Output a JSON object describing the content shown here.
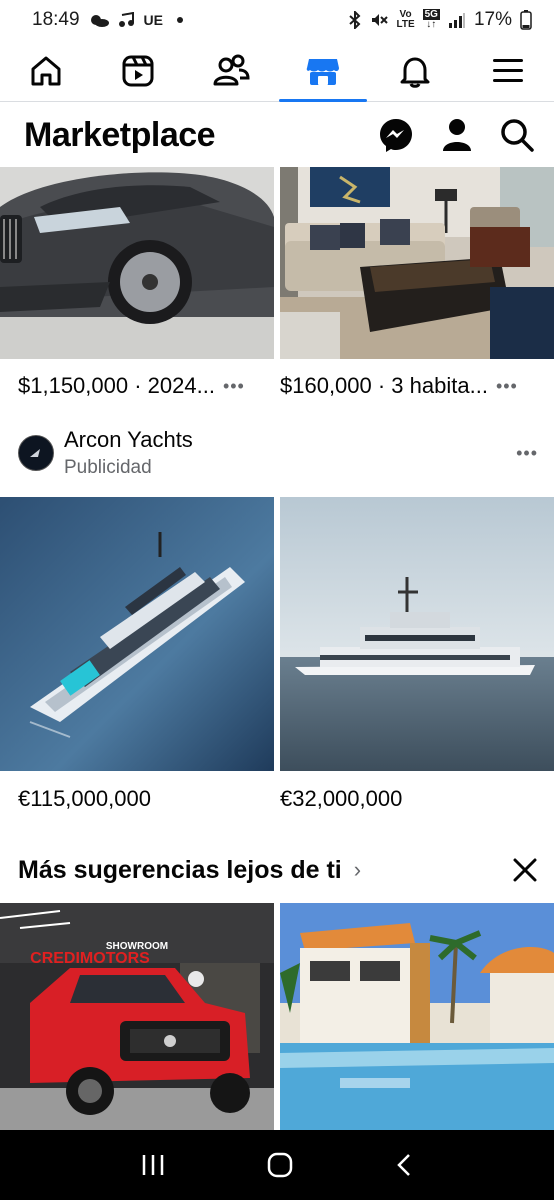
{
  "status": {
    "time": "18:49",
    "carrier": "UE",
    "network": "5G",
    "battery": "17%"
  },
  "nav": {
    "tabs": [
      "home",
      "reels",
      "friends",
      "marketplace",
      "notifications",
      "menu"
    ],
    "active": "marketplace"
  },
  "header": {
    "title": "Marketplace"
  },
  "listings_top": [
    {
      "price": "$1,150,000 · 2024...",
      "more": "•••"
    },
    {
      "price": "$160,000 · 3 habita...",
      "more": "•••"
    }
  ],
  "ad": {
    "name": "Arcon Yachts",
    "label": "Publicidad",
    "more": "•••"
  },
  "yacht_listings": [
    {
      "price": "€115,000,000"
    },
    {
      "price": "€32,000,000"
    }
  ],
  "suggestions": {
    "title": "Más sugerencias lejos de ti",
    "chevron": "›"
  },
  "dealer_sign": {
    "line1": "SHOWROOM",
    "line2": "CREDIMOTORS"
  },
  "colors": {
    "accent": "#1877f2",
    "text": "#050505",
    "secondary": "#65676b"
  }
}
